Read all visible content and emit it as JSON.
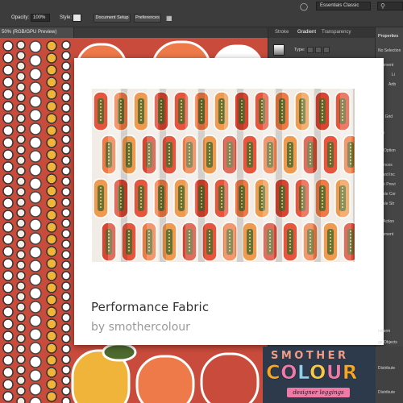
{
  "toolbar": {
    "opacity_label": "Opacity:",
    "opacity_value": "100%",
    "style_label": "Style:",
    "document_setup": "Document Setup",
    "preferences": "Preferences",
    "workspace": "Essentials Classic"
  },
  "document_tab": "50% (RGB/GPU Preview)",
  "panels": {
    "tabs": [
      "Stroke",
      "Gradient",
      "Transparency"
    ],
    "gradient_type_label": "Type:",
    "properties_title": "Properties",
    "properties_items": [
      "No Selection",
      "ocument",
      "Li",
      "Artb",
      "s & Grid",
      "des",
      "ap Option",
      "erences",
      "board Inc",
      "Use Previ",
      "Scale Cor",
      "Scale Str",
      "ck Action",
      "ocument"
    ]
  },
  "card": {
    "title": "Performance Fabric",
    "byline": "by smothercolour"
  },
  "logo": {
    "line1": "SMOTHER",
    "line2_letters": [
      "C",
      "O",
      "L",
      "O",
      "U",
      "R"
    ],
    "line2_colors": [
      "#f6a623",
      "#f07aa6",
      "#8fd1e8",
      "#f6c84a",
      "#f07aa6",
      "#f6a623"
    ],
    "tagline": "designer leggings"
  },
  "bottom_right_items": [
    "nsform",
    "ge Objects",
    "Distribute",
    "Distribute"
  ],
  "colors": {
    "fabric_red": "#c94b3b",
    "fabric_orange": "#ee7a4a",
    "fabric_yellow": "#f0b43a",
    "fabric_green": "#4d6b2e",
    "logo_bg": "#2c3a4c"
  }
}
